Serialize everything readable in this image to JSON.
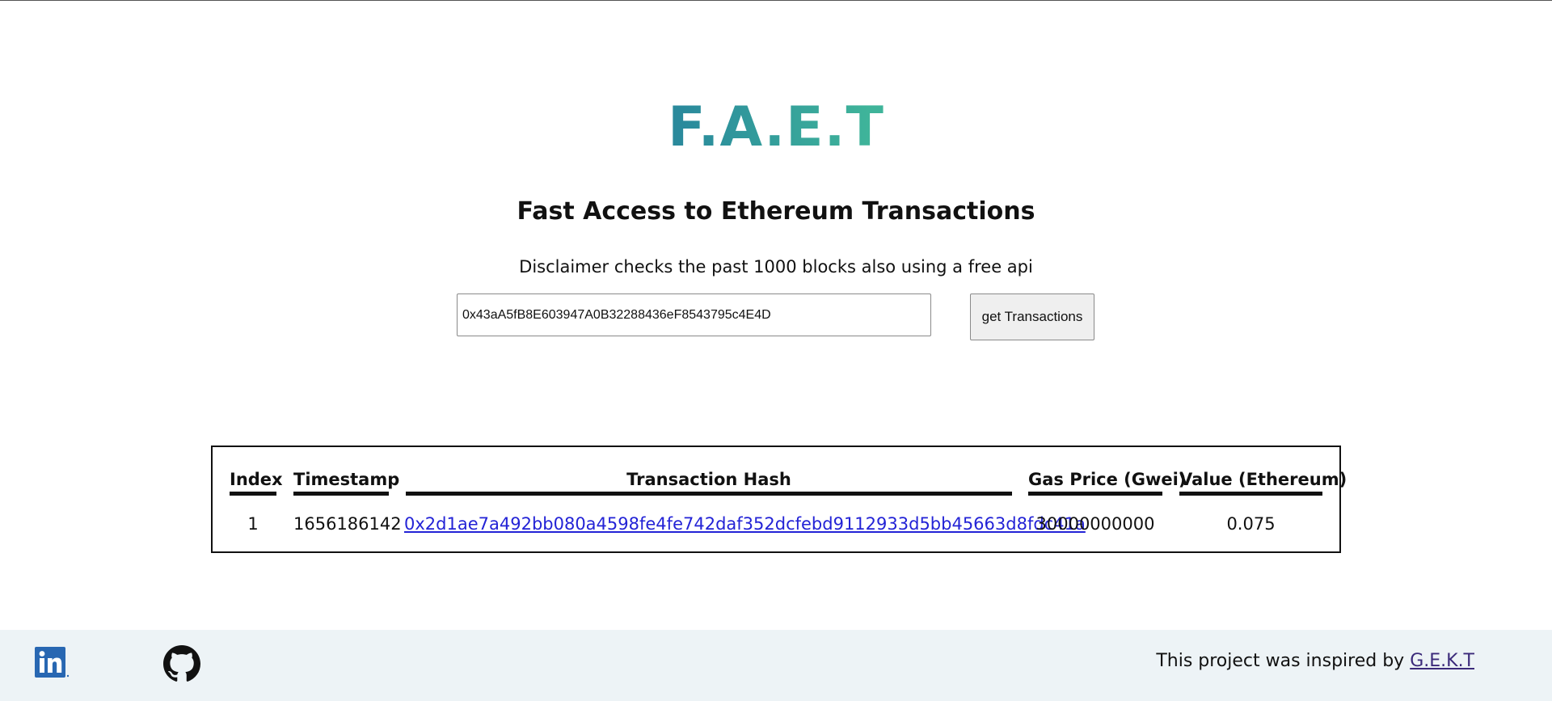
{
  "header": {
    "logo": "F.A.E.T",
    "subtitle": "Fast Access to Ethereum Transactions",
    "disclaimer": "Disclaimer checks the past 1000 blocks also using a free api"
  },
  "search": {
    "value": "0x43aA5fB8E603947A0B32288436eF8543795c4E4D",
    "button_label": "get Transactions"
  },
  "table": {
    "headers": [
      "Index",
      "Timestamp",
      "Transaction Hash",
      "Gas Price (Gwei)",
      "Value (Ethereum)"
    ],
    "rows": [
      {
        "index": "1",
        "timestamp": "1656186142",
        "hash": "0x2d1ae7a492bb080a4598fe4fe742daf352dcfebd9112933d5bb45663d8fdc41a",
        "gas_price": "30000000000",
        "value": "0.075"
      }
    ]
  },
  "footer": {
    "inspired_text": "This project was inspired by",
    "inspired_link": "G.E.K.T",
    "linkedin_icon": "linkedin-icon",
    "github_icon": "github-icon",
    "linkedin_color": "#2867b2",
    "background_color": "#edf3f6"
  },
  "colors": {
    "logo_gradient_start": "#2a8a9c",
    "logo_gradient_end": "#3fb49a",
    "link": "#2323d6"
  }
}
